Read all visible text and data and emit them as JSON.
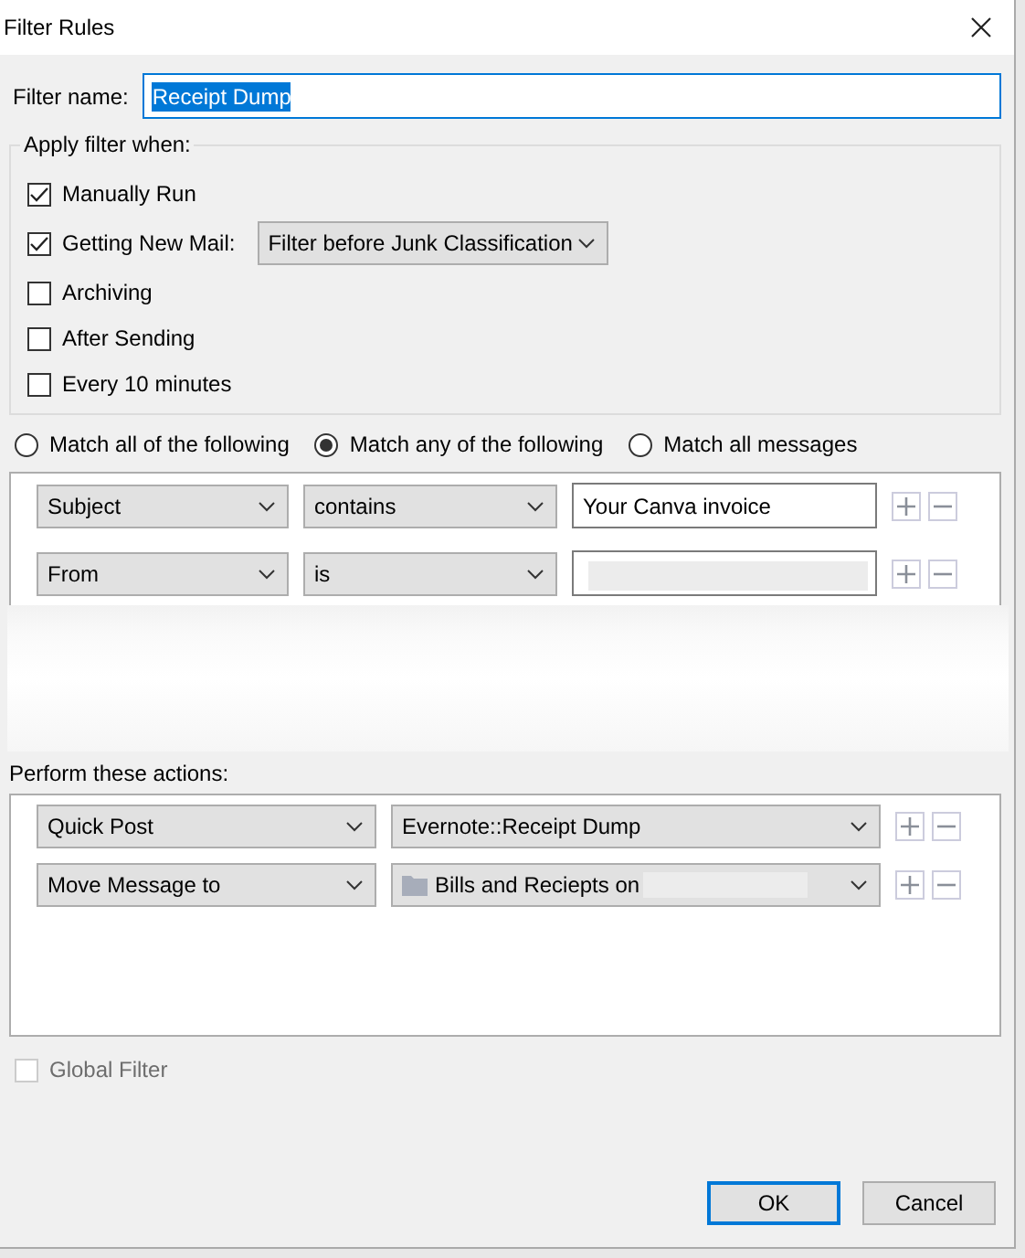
{
  "window": {
    "title": "Filter Rules"
  },
  "filter_name": {
    "label": "Filter name:",
    "value": "Receipt Dump",
    "text_selected": true
  },
  "apply_when": {
    "legend": "Apply filter when:",
    "options": [
      {
        "label": "Manually Run",
        "checked": true
      },
      {
        "label": "Getting New Mail:",
        "checked": true,
        "dropdown": "Filter before Junk Classification"
      },
      {
        "label": "Archiving",
        "checked": false
      },
      {
        "label": "After Sending",
        "checked": false
      },
      {
        "label": "Every 10 minutes",
        "checked": false
      }
    ]
  },
  "match_mode": [
    {
      "label": "Match all of the following",
      "selected": false
    },
    {
      "label": "Match any of the following",
      "selected": true
    },
    {
      "label": "Match all messages",
      "selected": false
    }
  ],
  "conditions": [
    {
      "field": "Subject",
      "operator": "contains",
      "value": "Your Canva invoice",
      "redacted": false
    },
    {
      "field": "From",
      "operator": "is",
      "redacted": true
    }
  ],
  "actions_label": "Perform these actions:",
  "actions": [
    {
      "action": "Quick Post",
      "target": "Evernote::Receipt Dump",
      "folder": false,
      "redacted": false
    },
    {
      "action": "Move Message to",
      "target": "Bills and Reciepts on",
      "folder": true,
      "redacted": true
    }
  ],
  "global_filter": {
    "label": "Global Filter",
    "checked": false,
    "disabled": true
  },
  "buttons": [
    {
      "label": "OK",
      "default": true
    },
    {
      "label": "Cancel",
      "default": false
    }
  ]
}
